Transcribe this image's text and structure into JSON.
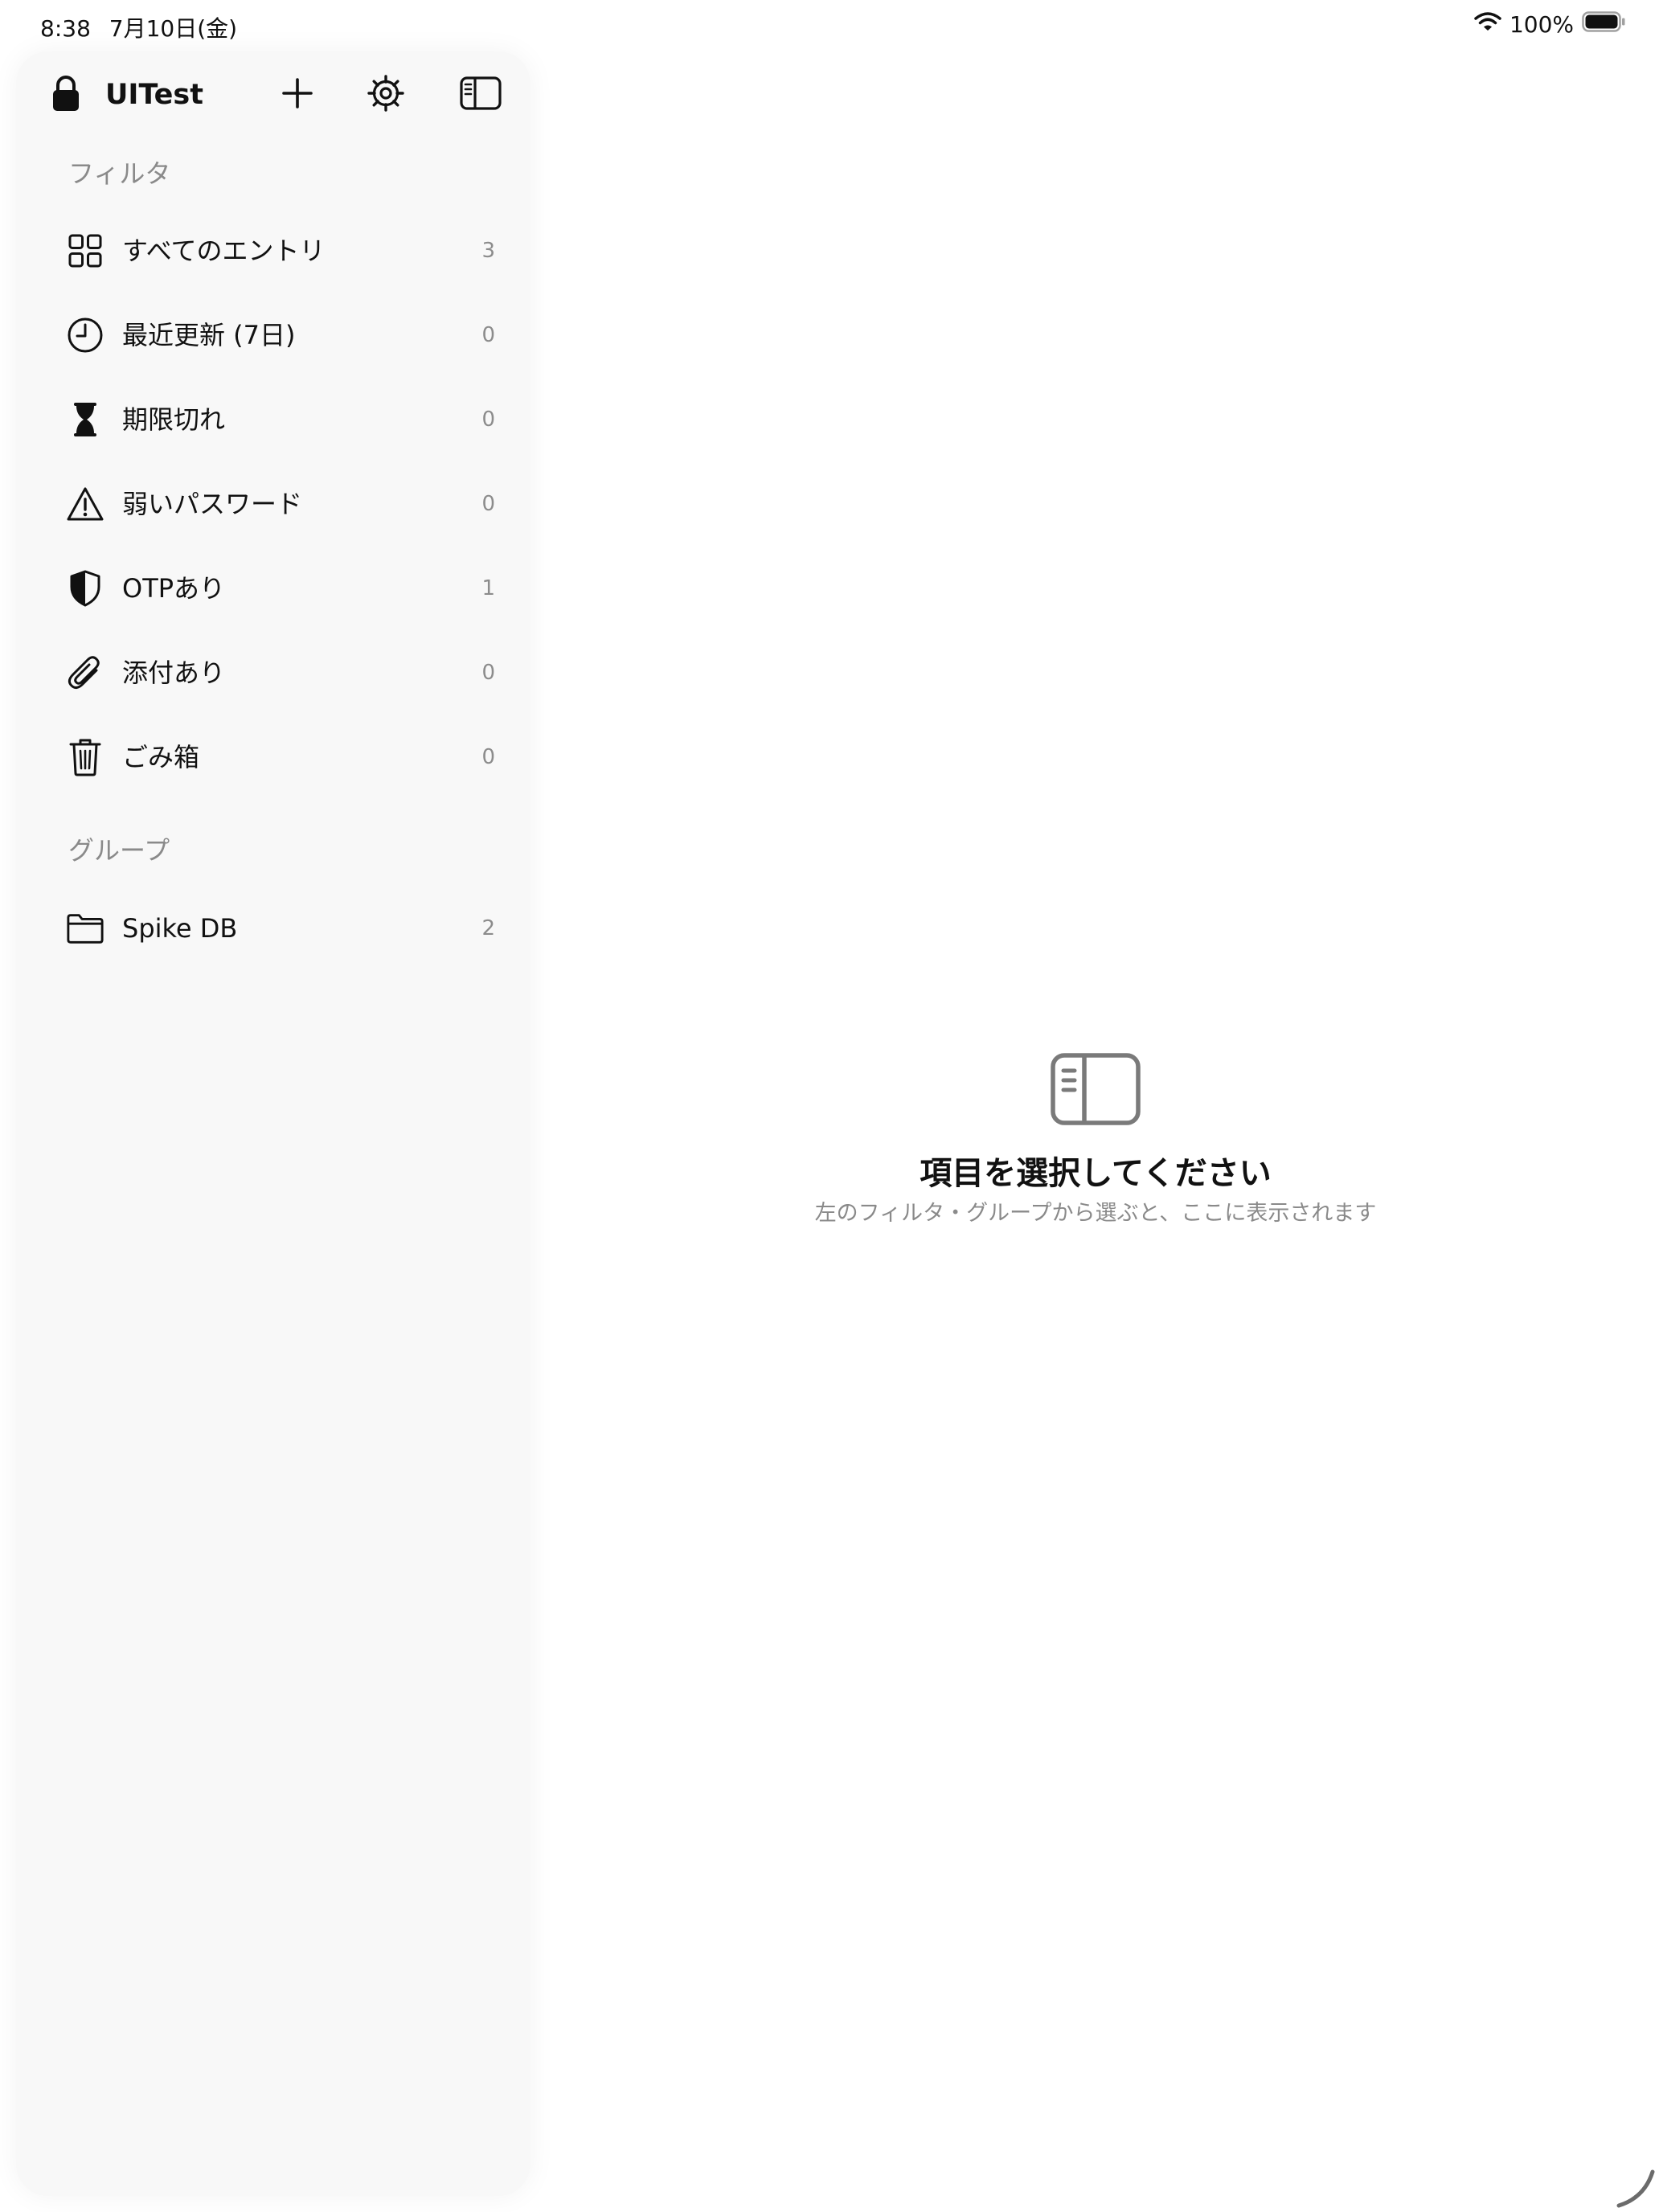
{
  "status_bar": {
    "time": "8:38",
    "date": "7月10日(金)",
    "battery": "100%",
    "wifi_icon": "wifi-icon",
    "battery_icon": "battery-icon"
  },
  "sidebar": {
    "toolbar": {
      "lock_icon": "lock-icon",
      "title": "UITest",
      "add_icon": "plus-icon",
      "settings_icon": "gear-icon",
      "toggle_icon": "sidebar-icon"
    },
    "sections": {
      "filters_header": "フィルタ",
      "groups_header": "グループ"
    },
    "filters": [
      {
        "label": "すべてのエントリ",
        "count": "3",
        "icon": "grid-icon"
      },
      {
        "label": "最近更新 (7日)",
        "count": "0",
        "icon": "clock-icon"
      },
      {
        "label": "期限切れ",
        "count": "0",
        "icon": "hourglass-icon"
      },
      {
        "label": "弱いパスワード",
        "count": "0",
        "icon": "warning-icon"
      },
      {
        "label": "OTPあり",
        "count": "1",
        "icon": "shield-icon"
      },
      {
        "label": "添付あり",
        "count": "0",
        "icon": "paperclip-icon"
      },
      {
        "label": "ごみ箱",
        "count": "0",
        "icon": "trash-icon"
      }
    ],
    "groups": [
      {
        "label": "Spike DB",
        "count": "2",
        "icon": "folder-icon"
      }
    ]
  },
  "detail": {
    "icon": "sidebar-icon",
    "title": "項目を選択してください",
    "subtitle": "左のフィルタ・グループから選ぶと、ここに表示されます"
  },
  "colors": {
    "sidebar_bg": "#f8f8f8",
    "secondary_text": "#8a8a8a",
    "primary_text": "#111111"
  }
}
